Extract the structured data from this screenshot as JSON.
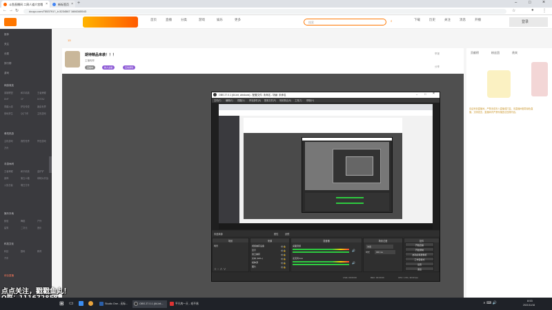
{
  "browser": {
    "tabs": [
      {
        "label": "斗鱼直播间 二周人道介宫哦"
      },
      {
        "label": "新标签页"
      }
    ],
    "url": "douyu.com/7553791?_t=3234567 1666345543",
    "new_tab": "+"
  },
  "header": {
    "nav": [
      "首页",
      "直播",
      "分类",
      "游戏",
      "娱乐",
      "更多"
    ],
    "search_placeholder": "搜索",
    "icons": [
      "下载",
      "历史",
      "关注",
      "消息",
      "开播",
      "登录"
    ]
  },
  "sidebar": {
    "items": [
      {
        "label": "推荐"
      },
      {
        "label": "关注"
      },
      {
        "label": "分类"
      },
      {
        "label": "排行榜"
      },
      {
        "label": "游戏"
      }
    ],
    "sections": [
      {
        "title": "网游竞技",
        "subs": [
          "英雄联盟",
          "和平精英",
          "王者荣耀",
          "DNF",
          "CF",
          "DOTA2",
          "穿越火线",
          "炉石传说",
          "魔兽世界",
          "绝地求生",
          "QQ飞车",
          "主机游戏"
        ]
      },
      {
        "title": "单机热游",
        "subs": [
          "主机游戏",
          "我的世界",
          "怀旧游戏",
          "方舟"
        ]
      },
      {
        "title": "手游休闲",
        "subs": [
          "王者荣耀",
          "和平精英",
          "金铲铲",
          "原神",
          "第五人格",
          "球球大作战",
          "火影忍者",
          "明日方舟"
        ]
      },
      {
        "title": "娱乐天地",
        "subs": [
          "颜值",
          "舞蹈",
          "户外",
          "星秀",
          "二次元",
          "音乐"
        ]
      },
      {
        "title": "科技文化",
        "subs": [
          "科技",
          "数码",
          "教育",
          "汽车"
        ]
      }
    ],
    "bottom": "综合直播"
  },
  "room": {
    "level": "13",
    "title": "期待精品来袭！！！",
    "owner": "主播昵称",
    "tags": [
      "直播中",
      "新人主播",
      "互动游戏"
    ],
    "report": "举报",
    "share": "分享"
  },
  "obs": {
    "title": "OBS 27.0.1 (64-bit, windows) - 配置文件: 未命名 - 场景: 未命名",
    "menu": [
      "文件(F)",
      "编辑(E)",
      "视图(V)",
      "停靠部件(D)",
      "配置文件(P)",
      "场景集合(S)",
      "工具(T)",
      "帮助(H)"
    ],
    "no_source_label": "未选择源",
    "properties_label": "属性",
    "filters_label": "滤镜",
    "docks": {
      "scenes": {
        "title": "场景",
        "items": [
          "场景"
        ]
      },
      "sources": {
        "title": "来源",
        "items": [
          "视频捕获设备",
          "显示",
          "窗口捕获",
          "文本 (GDI+)",
          "媒体源",
          "图片"
        ]
      },
      "mixer": {
        "title": "混音器",
        "items": [
          "桌面音频",
          "麦克风/Aux"
        ]
      },
      "transitions": {
        "title": "场景过渡",
        "fade": "淡出",
        "duration_label": "时长",
        "duration": "300 ms"
      },
      "controls": {
        "title": "控件",
        "buttons": [
          "开始直播",
          "开始录制",
          "启动虚拟摄像机",
          "工作室模式",
          "设置",
          "退出"
        ]
      }
    },
    "status": {
      "live": "LIVE: 00:00:00",
      "rec": "REC: 00:00:00",
      "cpu": "CPU: 1.5%, 30.00 fps"
    }
  },
  "rightpanel": {
    "tabs": [
      "贡献榜",
      "粉丝团",
      "贵宾"
    ],
    "notice": "欢迎来到直播间，严禁未成年人直播或打赏。本直播间倡导绿色直播，文明发言，直播间内严禁传播违法违规内容。"
  },
  "overlay": {
    "line1": "点点关注，戳戳鱼丸！",
    "line2": "Q群：111672858"
  },
  "taskbar": {
    "apps": [
      {
        "label": "Studio One - 无标..."
      },
      {
        "label": "OBS 27.0.1 (64-bit..."
      },
      {
        "label": "平凡的一天 - 毛不易"
      }
    ],
    "time": "8:53",
    "date": "2021/11/16"
  }
}
